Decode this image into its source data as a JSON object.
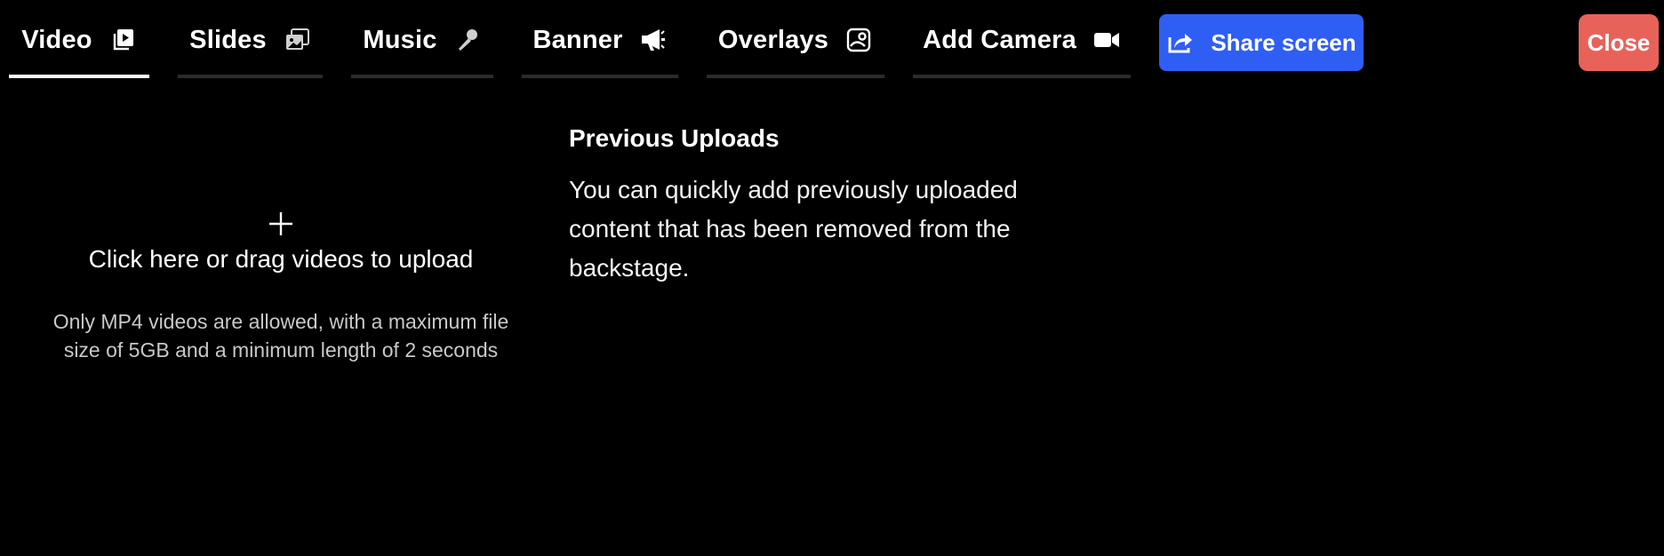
{
  "tabs": [
    {
      "label": "Video",
      "icon": "video-file-icon",
      "active": true
    },
    {
      "label": "Slides",
      "icon": "slides-icon",
      "active": false
    },
    {
      "label": "Music",
      "icon": "microphone-icon",
      "active": false
    },
    {
      "label": "Banner",
      "icon": "megaphone-icon",
      "active": false
    },
    {
      "label": "Overlays",
      "icon": "overlays-icon",
      "active": false
    },
    {
      "label": "Add Camera",
      "icon": "camera-icon",
      "active": false
    }
  ],
  "actions": {
    "share_label": "Share screen",
    "share_icon": "share-arrow-icon",
    "close_label": "Close"
  },
  "upload": {
    "title": "Click here or drag videos to upload",
    "help": "Only MP4 videos are allowed, with a maximum file size of 5GB and a minimum length of 2 seconds"
  },
  "previous_uploads": {
    "title": "Previous Uploads",
    "description": "You can quickly add previously uploaded content that has been removed from the backstage."
  },
  "colors": {
    "background": "#000000",
    "share_button": "#2f5ef5",
    "close_button": "#e8625a",
    "tab_underline_active": "#ffffff",
    "tab_underline_inactive": "#2a2b30"
  }
}
